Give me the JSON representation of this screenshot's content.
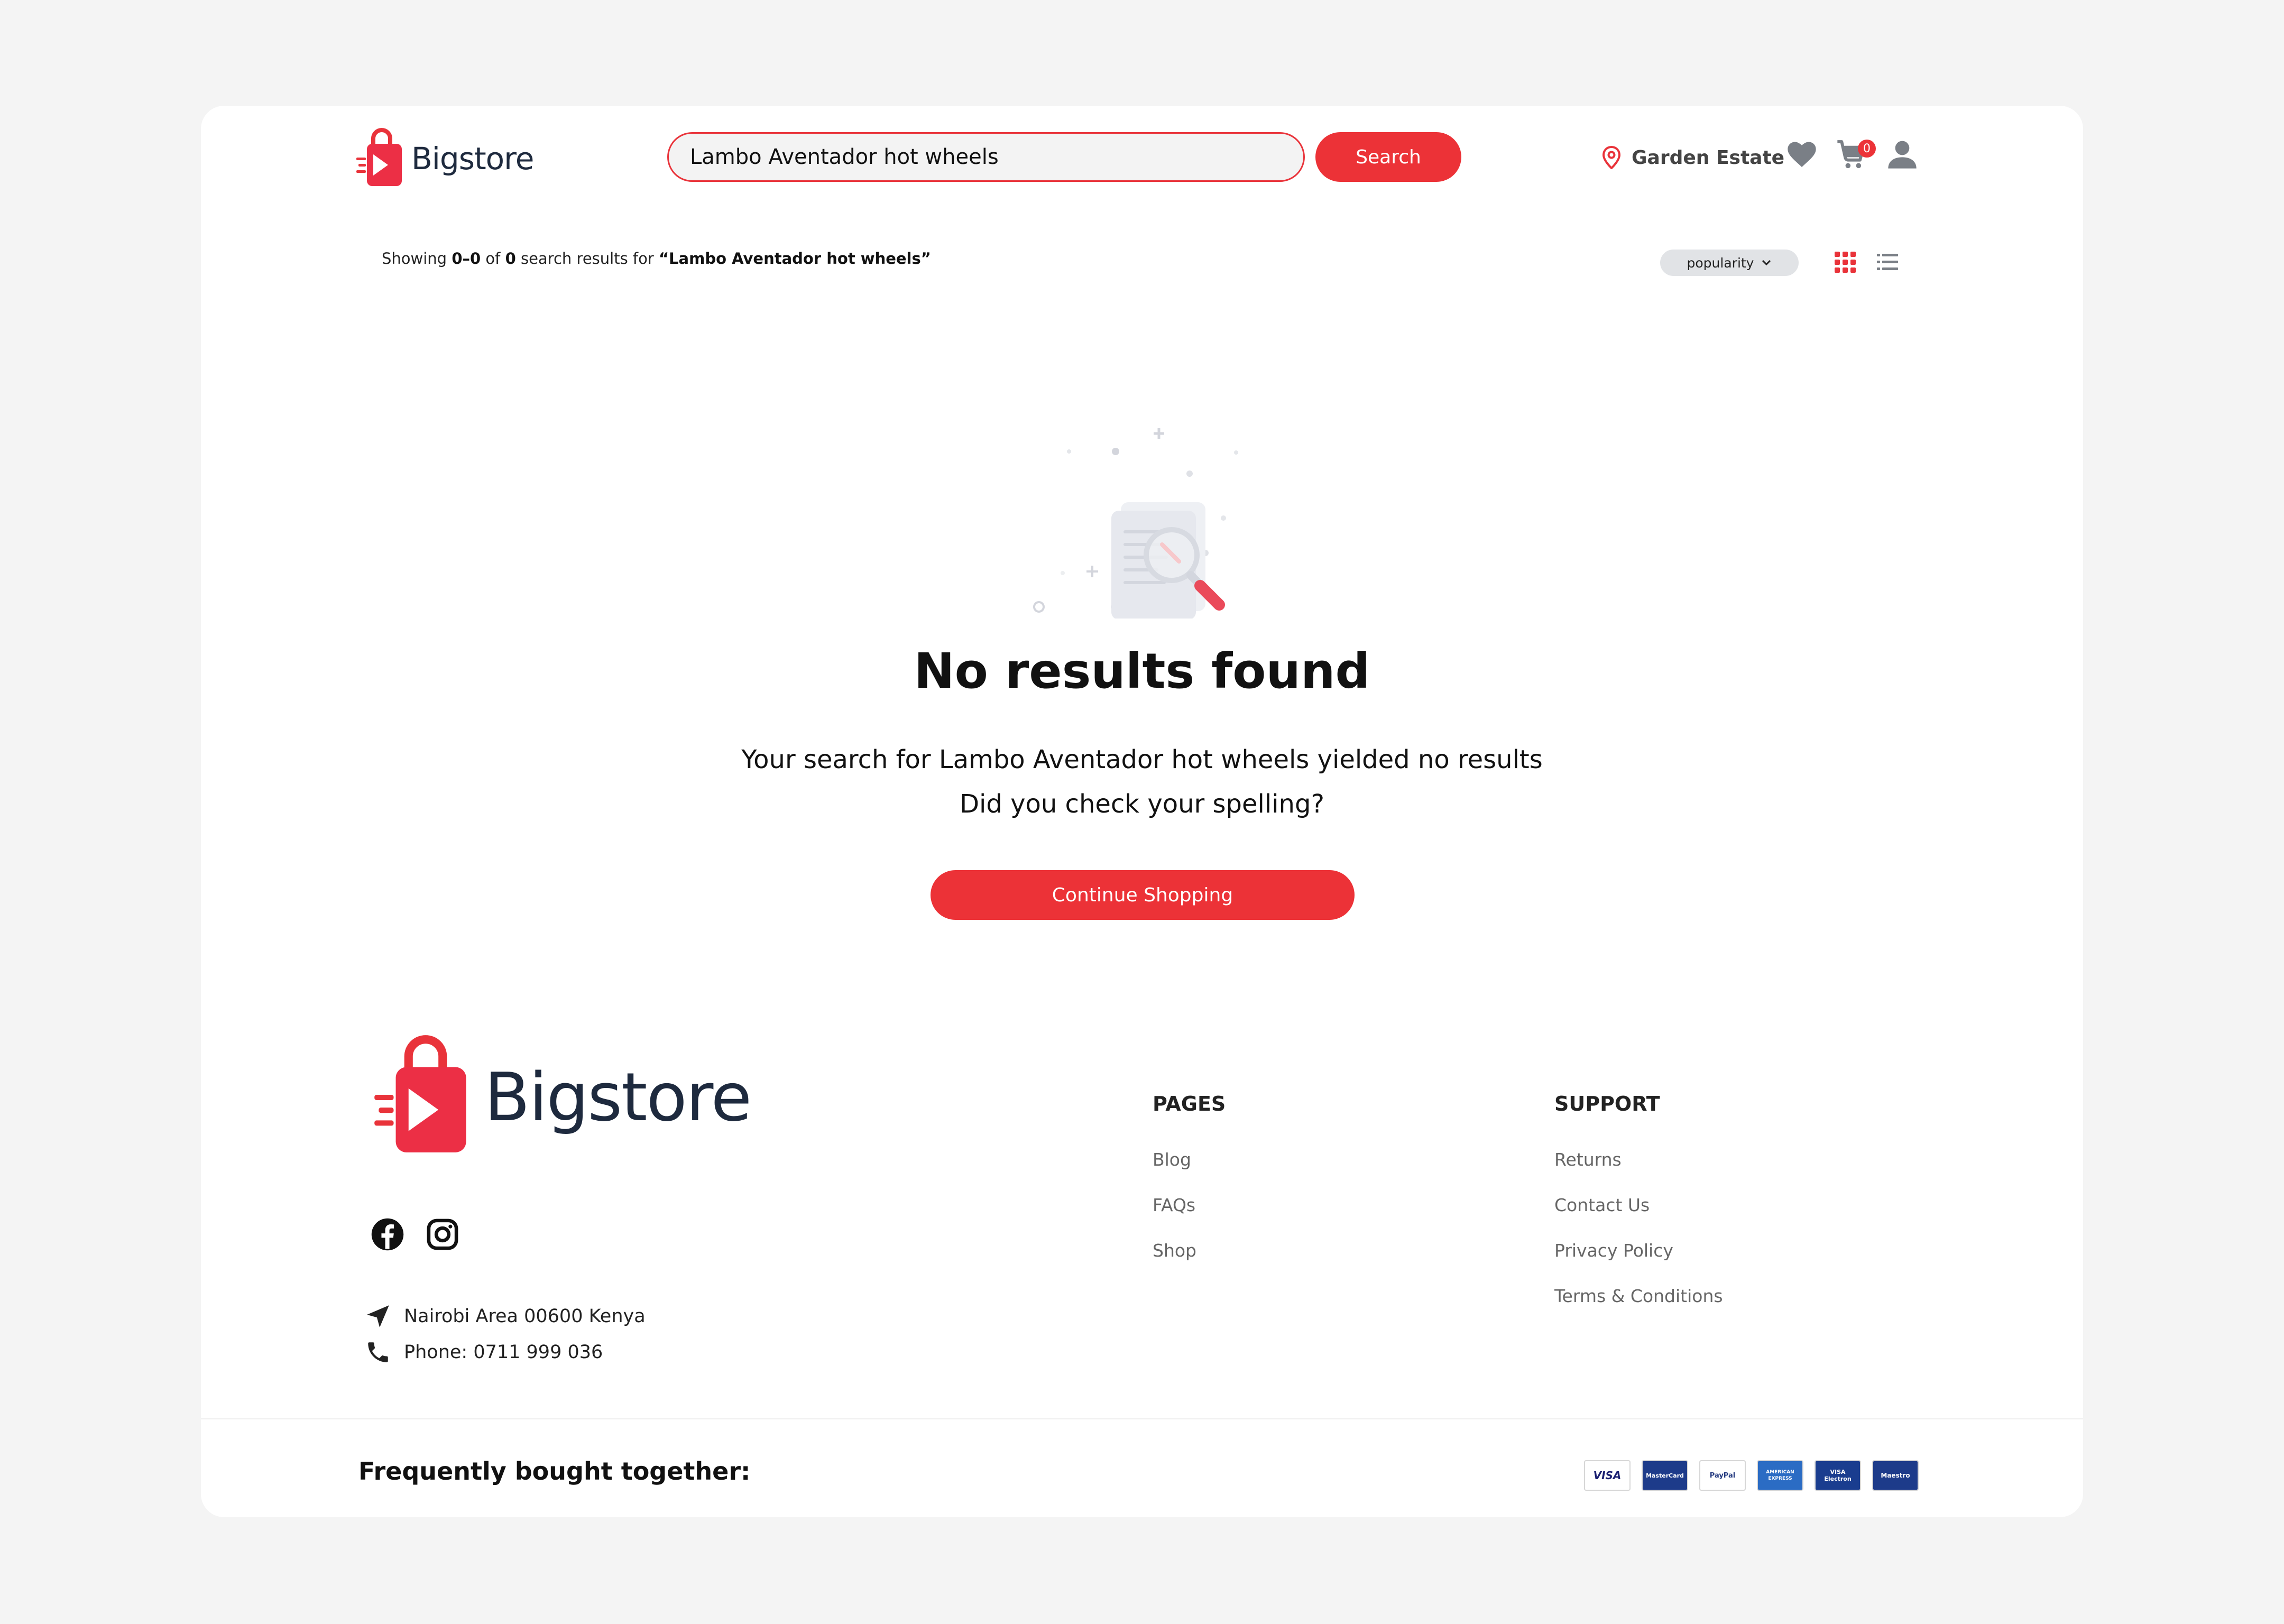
{
  "brand": {
    "name": "Bigstore",
    "color": "#e9333a",
    "text_color": "#1e2a3e"
  },
  "header": {
    "search_value": "Lambo Aventador hot wheels",
    "search_button": "Search",
    "location": "Garden Estate",
    "cart_count": "0",
    "icons": [
      "location-pin-icon",
      "heart-icon",
      "cart-icon",
      "user-icon"
    ]
  },
  "results": {
    "prefix": "Showing",
    "range": "0–0",
    "of": "of",
    "total": "0",
    "mid": "search results for",
    "query": "“Lambo Aventador hot wheels”",
    "sort_label": "popularity",
    "views": [
      "grid-view-icon",
      "list-view-icon"
    ]
  },
  "empty": {
    "title": "No results found",
    "message": "Your search for Lambo Aventador hot wheels yielded no results",
    "hint": "Did you check your spelling?",
    "button": "Continue Shopping"
  },
  "footer": {
    "social": [
      "facebook-icon",
      "instagram-icon"
    ],
    "address": "Nairobi Area 00600 Kenya",
    "phone": "Phone: 0711 999 036",
    "pages_title": "PAGES",
    "pages": [
      "Blog",
      "FAQs",
      "Shop"
    ],
    "support_title": "SUPPORT",
    "support": [
      "Returns",
      "Contact Us",
      "Privacy Policy",
      "Terms & Conditions"
    ],
    "frequently_bought": "Frequently bought together:",
    "payments": [
      "VISA",
      "MasterCard",
      "PayPal",
      "AMERICAN EXPRESS",
      "VISA Electron",
      "Maestro"
    ]
  }
}
